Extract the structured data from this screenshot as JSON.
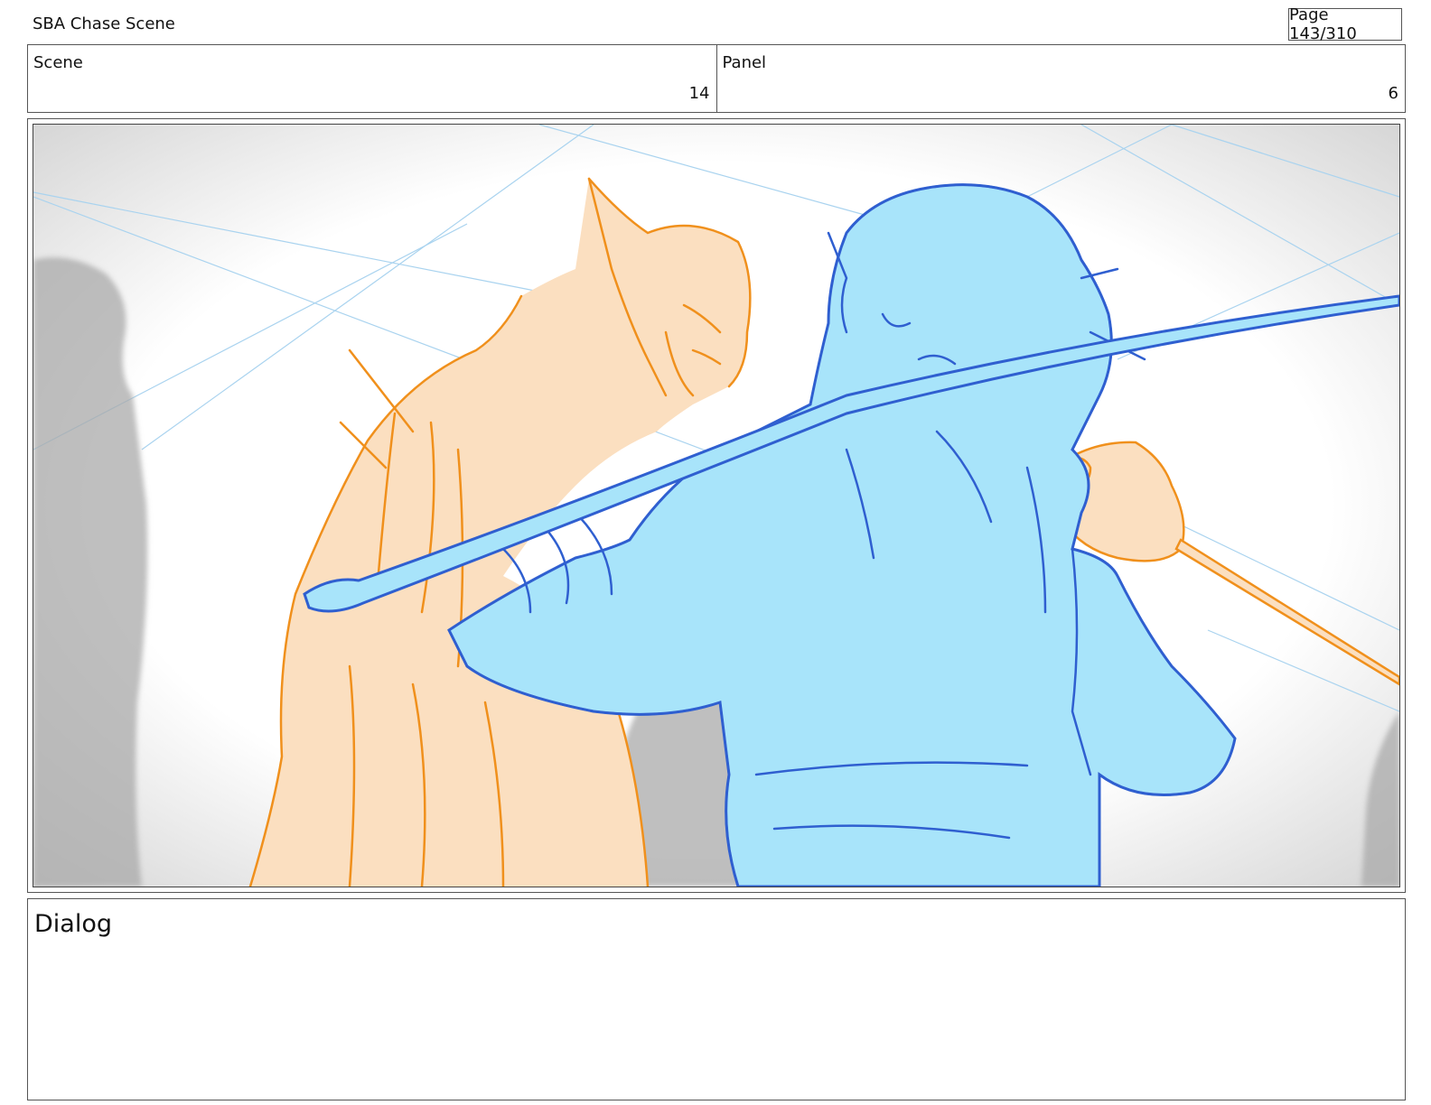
{
  "header": {
    "document_title": "SBA Chase Scene",
    "page_indicator": "Page 143/310"
  },
  "meta": {
    "scene_label": "Scene",
    "scene_value": "14",
    "panel_label": "Panel",
    "panel_value": "6"
  },
  "panel": {
    "colors": {
      "orange_fill": "#fbdfc0",
      "orange_line": "#f0901c",
      "blue_fill": "#a8e4fa",
      "blue_line": "#2f5fd0",
      "guide_line": "#a9d3ef",
      "background_figure": "#a9a9a9"
    }
  },
  "dialog": {
    "label": "Dialog"
  }
}
